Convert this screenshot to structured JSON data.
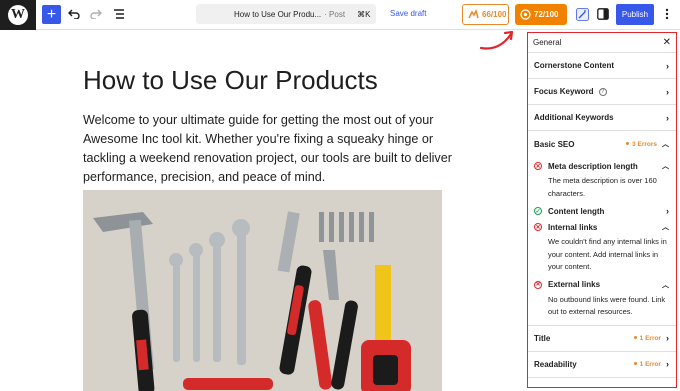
{
  "toolbar": {
    "doc_title": "How to Use Our Produ...",
    "doc_type": "· Post",
    "shortcut": "⌘K",
    "save_draft": "Save draft",
    "seo_score": "66/100",
    "readability_score": "72/100",
    "publish": "Publish"
  },
  "post": {
    "title": "How to Use Our Products",
    "body": "Welcome to your ultimate guide for getting the most out of your Awesome Inc tool kit. Whether you're fixing a squeaky hinge or tackling a weekend renovation project, our tools are built to deliver performance, precision, and peace of mind."
  },
  "sidebar": {
    "header": "General",
    "items": [
      {
        "label": "Cornerstone Content"
      },
      {
        "label": "Focus Keyword"
      },
      {
        "label": "Additional Keywords"
      }
    ],
    "basic_seo": {
      "label": "Basic SEO",
      "errors": "3 Errors",
      "checks": [
        {
          "title": "Meta description length",
          "status": "error",
          "desc": "The meta description is over 160 characters."
        },
        {
          "title": "Content length",
          "status": "ok",
          "desc": ""
        },
        {
          "title": "Internal links",
          "status": "error",
          "desc": "We couldn't find any internal links in your content. Add internal links in your content."
        },
        {
          "title": "External links",
          "status": "error",
          "desc": "No outbound links were found. Link out to external resources."
        }
      ]
    },
    "title_section": {
      "label": "Title",
      "errors": "1 Error"
    },
    "readability_section": {
      "label": "Readability",
      "errors": "1 Error"
    }
  },
  "colors": {
    "accent": "#3858e9",
    "orange": "#f18200",
    "error": "#e0262b",
    "ok": "#1a9e4b"
  }
}
